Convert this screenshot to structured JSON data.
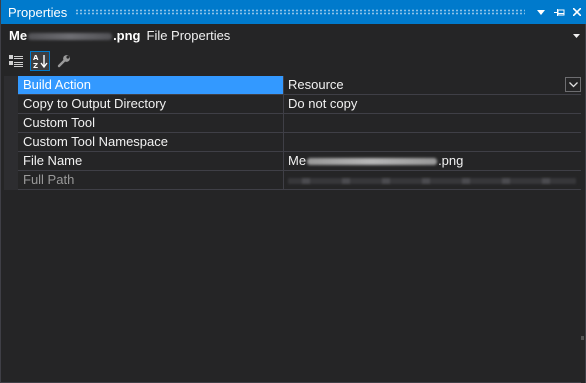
{
  "window": {
    "title": "Properties",
    "buttons": {
      "dropdown_icon": "chevron-down-icon",
      "pin_icon": "pin-icon",
      "close_icon": "close-icon"
    }
  },
  "selector": {
    "name_start": "Me",
    "name_end": ".png",
    "type_label": "File Properties"
  },
  "toolbar": {
    "categorized_icon": "categorized-icon",
    "alphabetical_icon": "alphabetical-sort-icon",
    "property_pages_icon": "wrench-icon"
  },
  "properties": [
    {
      "name": "Build Action",
      "value": "Resource",
      "selected": true
    },
    {
      "name": "Copy to Output Directory",
      "value": "Do not copy"
    },
    {
      "name": "Custom Tool",
      "value": ""
    },
    {
      "name": "Custom Tool Namespace",
      "value": ""
    },
    {
      "name": "File Name",
      "value_start": "Me",
      "value_end": ".png"
    },
    {
      "name": "Full Path",
      "value": "",
      "disabled": true
    }
  ],
  "colors": {
    "accent": "#007acc",
    "selection": "#3399ff",
    "background": "#252526",
    "grid_line": "#3f3f46"
  }
}
